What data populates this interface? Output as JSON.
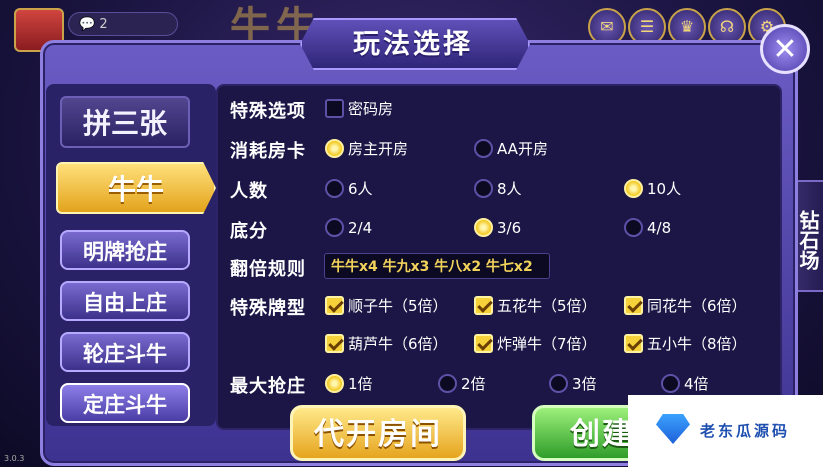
{
  "topbar": {
    "coin_count": "2",
    "bg_title": "牛牛",
    "icons": [
      "mail-icon",
      "list-icon",
      "trophy-icon",
      "headset-icon",
      "gear-icon"
    ]
  },
  "right_tab": {
    "label": "钻石场"
  },
  "dialog": {
    "title": "玩法选择",
    "close_label": "✕"
  },
  "sidebar": {
    "games": [
      {
        "label": "拼三张",
        "active": false
      },
      {
        "label": "牛牛",
        "active": true
      }
    ],
    "modes": [
      {
        "label": "明牌抢庄",
        "selected": false
      },
      {
        "label": "自由上庄",
        "selected": false
      },
      {
        "label": "轮庄斗牛",
        "selected": false
      },
      {
        "label": "定庄斗牛",
        "selected": true
      }
    ]
  },
  "rows": {
    "special_option": {
      "label": "特殊选项",
      "options": [
        {
          "label": "密码房",
          "checked": false
        }
      ]
    },
    "room_card": {
      "label": "消耗房卡",
      "options": [
        {
          "label": "房主开房",
          "selected": true
        },
        {
          "label": "AA开房",
          "selected": false
        }
      ]
    },
    "players": {
      "label": "人数",
      "options": [
        {
          "label": "6人",
          "selected": false
        },
        {
          "label": "8人",
          "selected": false
        },
        {
          "label": "10人",
          "selected": true
        }
      ]
    },
    "base_score": {
      "label": "底分",
      "options": [
        {
          "label": "2/4",
          "selected": false
        },
        {
          "label": "3/6",
          "selected": true
        },
        {
          "label": "4/8",
          "selected": false
        }
      ]
    },
    "multiplier_rule": {
      "label": "翻倍规则",
      "value": "牛牛x4 牛九x3 牛八x2 牛七x2"
    },
    "special_hands": {
      "label": "特殊牌型",
      "options": [
        {
          "label": "顺子牛（5倍）",
          "checked": true
        },
        {
          "label": "五花牛（5倍）",
          "checked": true
        },
        {
          "label": "同花牛（6倍）",
          "checked": true
        },
        {
          "label": "葫芦牛（6倍）",
          "checked": true
        },
        {
          "label": "炸弹牛（7倍）",
          "checked": true
        },
        {
          "label": "五小牛（8倍）",
          "checked": true
        }
      ]
    },
    "max_grab": {
      "label": "最大抢庄",
      "options": [
        {
          "label": "1倍",
          "selected": true
        },
        {
          "label": "2倍",
          "selected": false
        },
        {
          "label": "3倍",
          "selected": false
        },
        {
          "label": "4倍",
          "selected": false
        }
      ]
    }
  },
  "buttons": {
    "proxy_open": "代开房间",
    "create": "创建"
  },
  "watermark": {
    "text": "老东瓜源码"
  },
  "version": "3.0.3",
  "colors": {
    "accent_gold": "#f2c517",
    "panel_purple": "#6a5cc4",
    "create_green": "#2f9d2a"
  }
}
